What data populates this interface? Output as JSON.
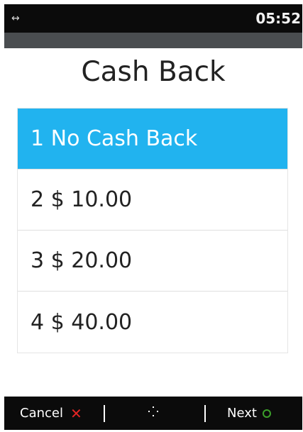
{
  "status_bar": {
    "icon": "link-arrows-icon",
    "icon_glyph": "↔",
    "time": "05:52"
  },
  "screen": {
    "title": "Cash Back"
  },
  "options": [
    {
      "label": "1 No Cash Back",
      "selected": true
    },
    {
      "label": "2 $ 10.00",
      "selected": false
    },
    {
      "label": "3 $ 20.00",
      "selected": false
    },
    {
      "label": "4 $ 40.00",
      "selected": false
    }
  ],
  "footer": {
    "cancel_label": "Cancel",
    "cancel_icon": "close-icon",
    "cancel_glyph": "✕",
    "center_icon": "dots-icon",
    "next_label": "Next",
    "next_icon": "circle-icon"
  },
  "colors": {
    "selected_bg": "#21b3ef",
    "cancel_icon": "#e32424",
    "next_icon": "#3ca02a"
  }
}
